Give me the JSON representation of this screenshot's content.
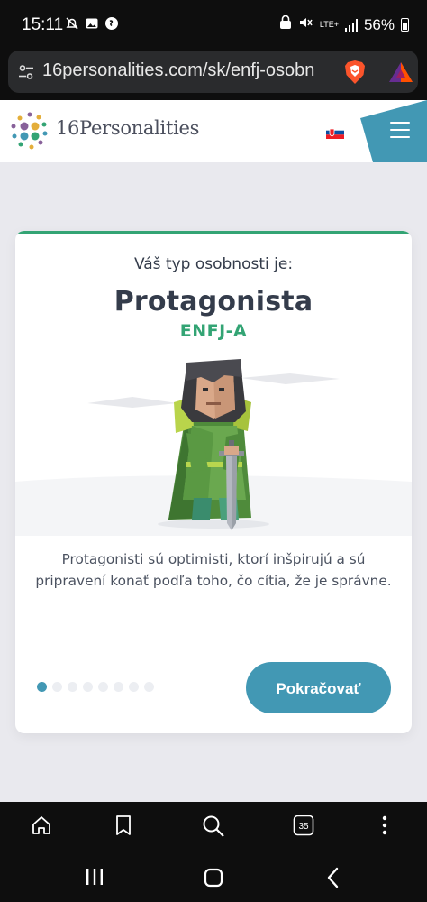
{
  "status_bar": {
    "time": "15:11",
    "network": "LTE+",
    "battery": "56%"
  },
  "browser": {
    "url": "16personalities.com/sk/enfj-osobn",
    "tab_count": "35"
  },
  "site": {
    "logo_text": "16Personalities"
  },
  "result_card": {
    "intro": "Váš typ osobnosti je:",
    "type_name": "Protagonista",
    "type_code": "ENFJ-A",
    "description": "Protagonisti sú optimisti, ktorí inšpirujú a sú pripravení konať podľa toho, čo cítia, že je správne.",
    "continue_label": "Pokračovať",
    "pagination": {
      "total": 8,
      "current": 1
    }
  },
  "colors": {
    "accent_green": "#33a474",
    "accent_blue": "#4298b4",
    "title_text": "#343c4b"
  },
  "icons": [
    "home-icon",
    "bookmark-icon",
    "search-icon",
    "tabs-icon",
    "more-vertical-icon",
    "recent-apps-icon",
    "home-nav-icon",
    "back-icon"
  ]
}
